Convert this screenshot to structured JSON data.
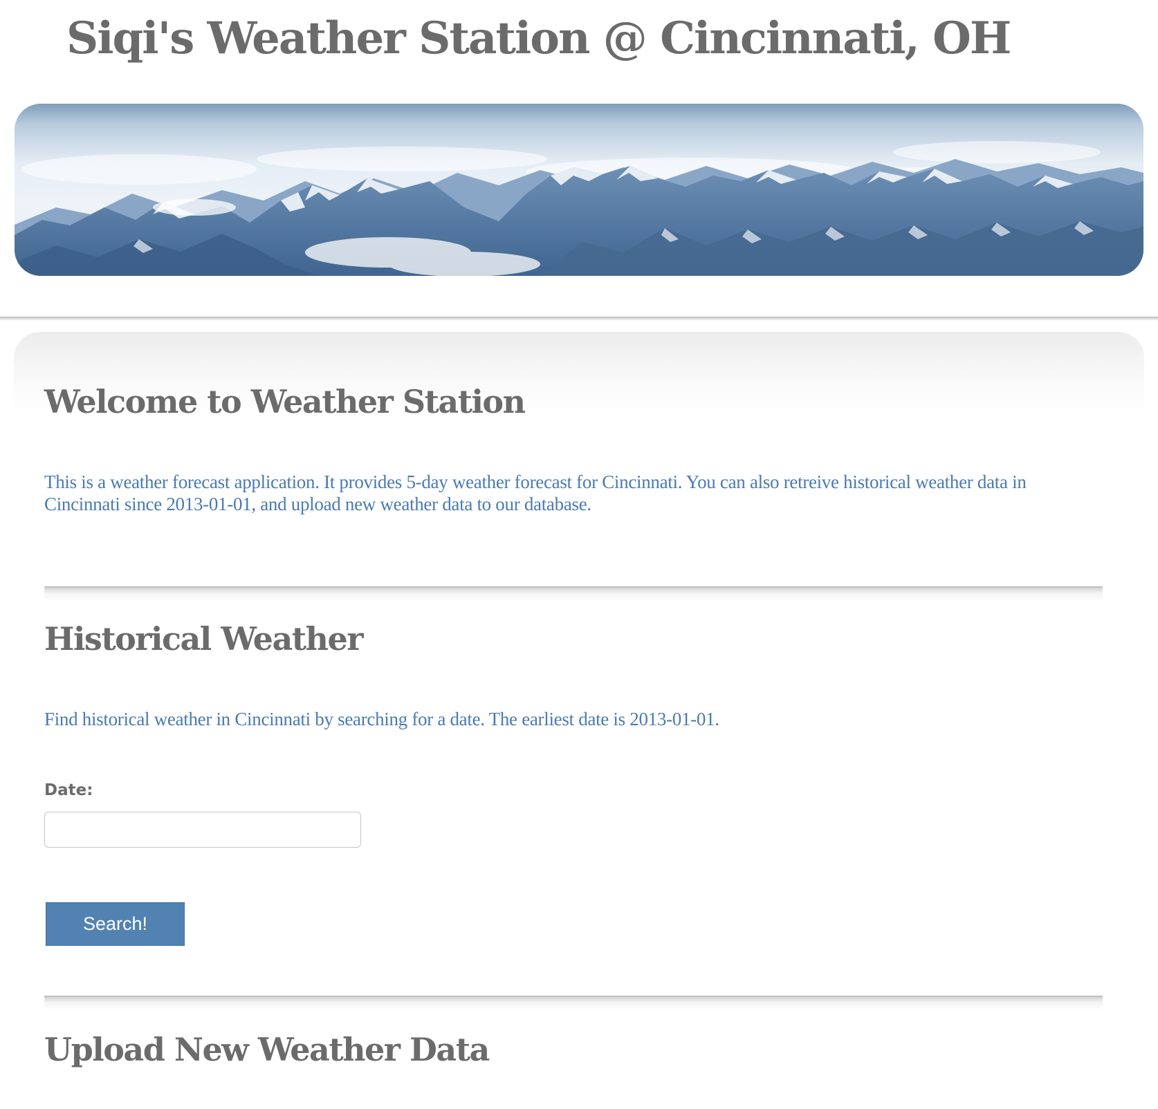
{
  "header": {
    "title": "Siqi's Weather Station @ Cincinnati, OH"
  },
  "welcome": {
    "heading": "Welcome to Weather Station",
    "text": "This is a weather forecast application. It provides 5-day weather forecast for Cincinnati. You can also retreive historical weather data in Cincinnati since 2013-01-01, and upload new weather data to our database."
  },
  "historical": {
    "heading": "Historical Weather",
    "text": "Find historical weather in Cincinnati by searching for a date. The earliest date is 2013-01-01.",
    "date_label": "Date:",
    "date_value": "",
    "search_label": "Search!"
  },
  "upload": {
    "heading": "Upload New Weather Data"
  },
  "colors": {
    "heading": "#6b6b6b",
    "body_text": "#4a7ab0",
    "button": "#5282b2",
    "banner_mountain": "#4f74a0"
  }
}
